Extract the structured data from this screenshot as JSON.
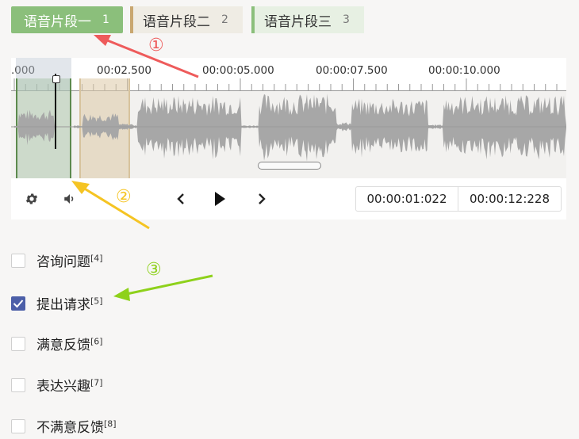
{
  "segments": [
    {
      "label": "语音片段一",
      "num": "1"
    },
    {
      "label": "语音片段二",
      "num": "2"
    },
    {
      "label": "语音片段三",
      "num": "3"
    }
  ],
  "ruler": {
    "labels": [
      ".000",
      "00:02.500",
      "00:00:05.000",
      "00:00:07.500",
      "00:00:10.000"
    ]
  },
  "player": {
    "current_time": "00:00:01:022",
    "total_time": "00:00:12:228",
    "icons": [
      "gear-icon",
      "volume-icon",
      "chevron-left-icon",
      "play-icon",
      "chevron-right-icon"
    ]
  },
  "annotations": {
    "marker1": "①",
    "marker2": "②",
    "marker3": "③",
    "colors": {
      "marker1": "#ee5b5b",
      "marker2": "#f5c423",
      "marker3": "#8ed11b"
    }
  },
  "labels": [
    {
      "text": "咨询问题",
      "count": "[4]",
      "checked": false
    },
    {
      "text": "提出请求",
      "count": "[5]",
      "checked": true
    },
    {
      "text": "满意反馈",
      "count": "[6]",
      "checked": false
    },
    {
      "text": "表达兴趣",
      "count": "[7]",
      "checked": false
    },
    {
      "text": "不满意反馈",
      "count": "[8]",
      "checked": false
    }
  ],
  "colors": {
    "accent_green": "#8bbf7b",
    "accent_tan": "#c9a770",
    "checkbox_blue": "#4c5fa8"
  }
}
